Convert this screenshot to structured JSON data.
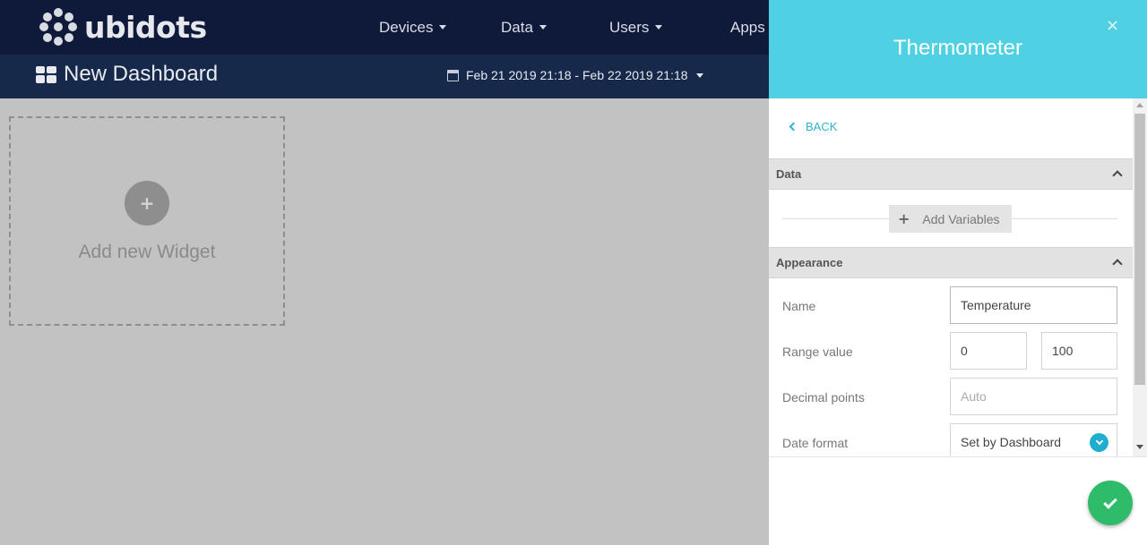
{
  "brand": {
    "name": "ubidots",
    "logo_icon": "dots-logo-icon"
  },
  "nav": {
    "items": [
      {
        "label": "Devices"
      },
      {
        "label": "Data"
      },
      {
        "label": "Users"
      },
      {
        "label": "Apps"
      }
    ]
  },
  "dashboard": {
    "title": "New Dashboard",
    "date_range": "Feb 21 2019 21:18 - Feb 22 2019 21:18"
  },
  "canvas": {
    "add_widget_label": "Add new Widget",
    "add_widget_icon": "+"
  },
  "panel": {
    "title": "Thermometer",
    "close_glyph": "×",
    "back_label": "BACK",
    "sections": {
      "data": {
        "label": "Data",
        "add_variables_label": "Add Variables",
        "add_glyph": "+"
      },
      "appearance": {
        "label": "Appearance"
      }
    },
    "fields": {
      "name": {
        "label": "Name",
        "value": "Temperature"
      },
      "range": {
        "label": "Range value",
        "min": "0",
        "max": "100"
      },
      "decimal": {
        "label": "Decimal points",
        "placeholder": "Auto"
      },
      "date_format": {
        "label": "Date format",
        "value": "Set by Dashboard"
      }
    }
  },
  "colors": {
    "topbar": "#0f1a3a",
    "subbar": "#17294a",
    "panel_header": "#4fd0e3",
    "accent": "#2cb5cf",
    "confirm": "#2fbc6a"
  }
}
